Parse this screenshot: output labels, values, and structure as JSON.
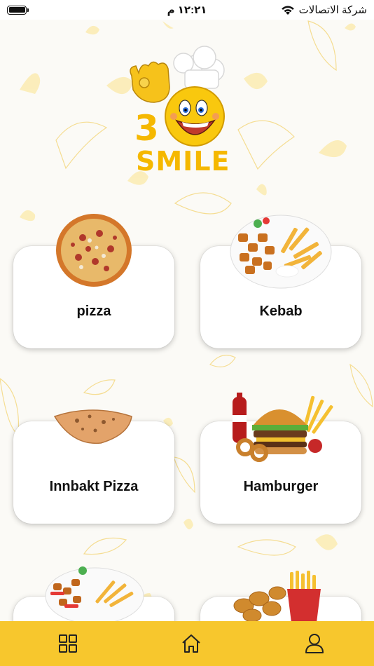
{
  "status_bar": {
    "carrier": "شركة الاتصالات",
    "time": "١٢:٢١ م"
  },
  "logo": {
    "number": "3",
    "word": "SMILE"
  },
  "categories": [
    {
      "label": "pizza",
      "image": "pizza-image"
    },
    {
      "label": "Kebab",
      "image": "kebab-plate-image"
    },
    {
      "label": "Innbakt Pizza",
      "image": "calzone-image"
    },
    {
      "label": "Hamburger",
      "image": "hamburger-meal-image"
    },
    {
      "label": "",
      "image": "chicken-plate-image"
    },
    {
      "label": "",
      "image": "nuggets-fries-image"
    }
  ],
  "bottom_nav": {
    "items": [
      "grid-icon",
      "home-icon",
      "profile-icon"
    ]
  },
  "colors": {
    "accent": "#f7c72d",
    "logo_text": "#f5b800",
    "background": "#fbfaf6"
  }
}
